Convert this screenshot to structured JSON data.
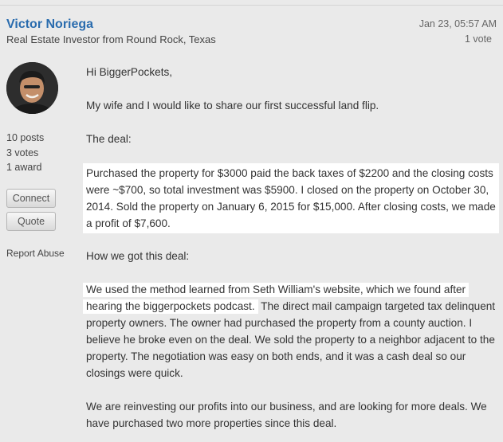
{
  "post": {
    "author_name": "Victor Noriega",
    "author_title": "Real Estate Investor from Round Rock, Texas",
    "date": "Jan 23, 05:57 AM",
    "votes": "1 vote"
  },
  "author_stats": {
    "posts": "10 posts",
    "votes": "3 votes",
    "awards": "1 award"
  },
  "actions": {
    "connect": "Connect",
    "quote": "Quote",
    "report": "Report Abuse"
  },
  "content": {
    "greeting": "Hi BiggerPockets,",
    "intro": "My wife and I would like to share our first successful land flip.",
    "deal_heading": "The deal:",
    "deal_body": "Purchased the property for $3000 paid the back taxes of $2200 and the closing costs were ~$700, so total investment was $5900.  I closed on the property on October 30, 2014.  Sold the property on January 6, 2015 for $15,000.  After closing costs, we made a profit of $7,600.",
    "how_heading": "How we got this deal:",
    "how_highlight": "We used the method learned from Seth William's website, which we found after hearing the biggerpockets podcast.",
    "how_rest": " The direct mail campaign targeted tax delinquent property owners.  The owner had purchased the property from a county auction.  I believe he broke even on the deal.  We sold the property to a neighbor adjacent to the property.  The negotiation was easy on both ends, and it was a cash deal so our closings were quick.",
    "closing": "We are reinvesting our profits into our business, and are looking for more deals.  We have purchased two more properties since this deal."
  },
  "colors": {
    "author_link": "#2a6cae",
    "background": "#eaeaea",
    "highlight": "#ffffff"
  }
}
